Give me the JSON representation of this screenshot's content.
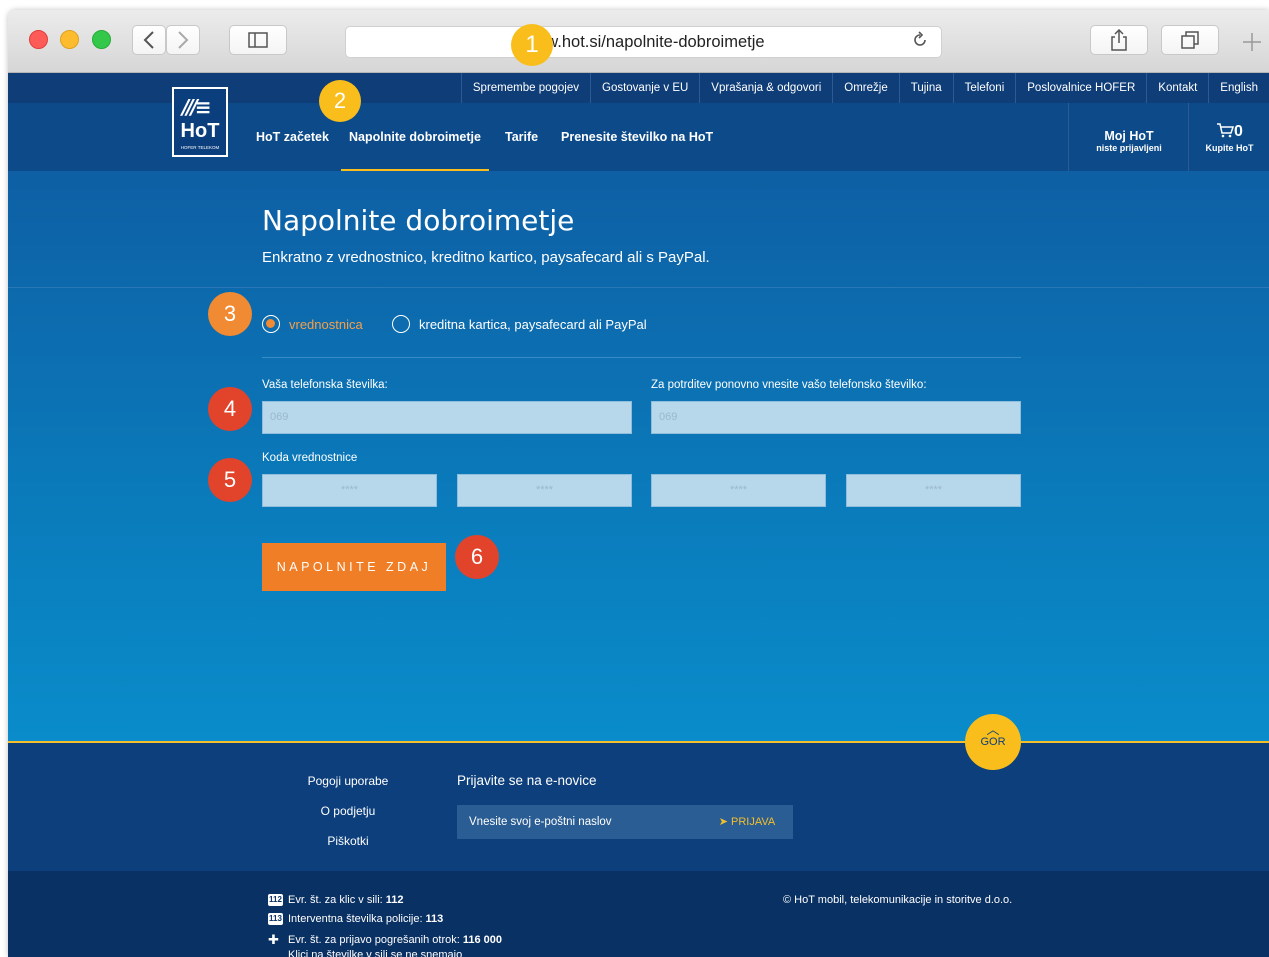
{
  "browser": {
    "url": "www.hot.si/napolnite-dobroimetje",
    "back_icon": "chevron-left-icon",
    "forward_icon": "chevron-right-icon",
    "sidebar_icon": "sidebar-icon",
    "reload_icon": "reload-icon",
    "share_icon": "share-icon",
    "tabs_icon": "tabs-icon",
    "new_tab_icon": "plus-icon"
  },
  "badges": [
    "1",
    "2",
    "3",
    "4",
    "5",
    "6"
  ],
  "topbar": {
    "links": [
      "Spremembe pogojev",
      "Gostovanje v EU",
      "Vprašanja & odgovori",
      "Omrežje",
      "Tujina",
      "Telefoni",
      "Poslovalnice HOFER",
      "Kontakt",
      "English"
    ]
  },
  "logo": {
    "title": "HoT",
    "subtitle": "HOFER TELEKOM"
  },
  "nav": {
    "items": [
      "HoT začetek",
      "Napolnite dobroimetje",
      "Tarife",
      "Prenesite številko na HoT"
    ],
    "active_index": 1,
    "account_title": "Moj HoT",
    "account_status": "niste prijavljeni",
    "cart_count": "0",
    "cart_label": "Kupite HoT"
  },
  "hero": {
    "title": "Napolnite dobroimetje",
    "subtitle": "Enkratno z vrednostnico, kreditno kartico, paysafecard ali s PayPal."
  },
  "form": {
    "options": [
      "vrednostnica",
      "kreditna kartica, paysafecard ali PayPal"
    ],
    "selected_option": 0,
    "phone_label": "Vaša telefonska številka:",
    "phone_placeholder": "069",
    "confirm_label": "Za potrditev ponovno vnesite vašo telefonsko številko:",
    "confirm_placeholder": "069",
    "voucher_label": "Koda vrednostnice",
    "voucher_placeholder": "****",
    "submit_label": "NAPOLNITE ZDAJ"
  },
  "footer": {
    "links": [
      "Pogoji uporabe",
      "O podjetju",
      "Piškotki"
    ],
    "newsletter_title": "Prijavite se na e-novice",
    "newsletter_placeholder": "Vnesite svoj e-poštni naslov",
    "newsletter_button": "PRIJAVA",
    "top_button": "GOR",
    "emergency": [
      {
        "text": "Evr. št. za klic v sili:",
        "number": "112",
        "icon": "112"
      },
      {
        "text": "Interventna številka policije:",
        "number": "113",
        "icon": "113"
      },
      {
        "text": "Evr. št. za prijavo pogrešanih otrok:",
        "number": "116 000",
        "icon": "puzzle-icon"
      }
    ],
    "emergency_note": "Klici na številke v sili se ne snemajo",
    "copyright": "© HoT mobil, telekomunikacije in storitve d.o.o."
  },
  "colors": {
    "accent_orange": "#f07e26",
    "accent_yellow": "#f9be1b",
    "navy": "#0c4a8a"
  }
}
